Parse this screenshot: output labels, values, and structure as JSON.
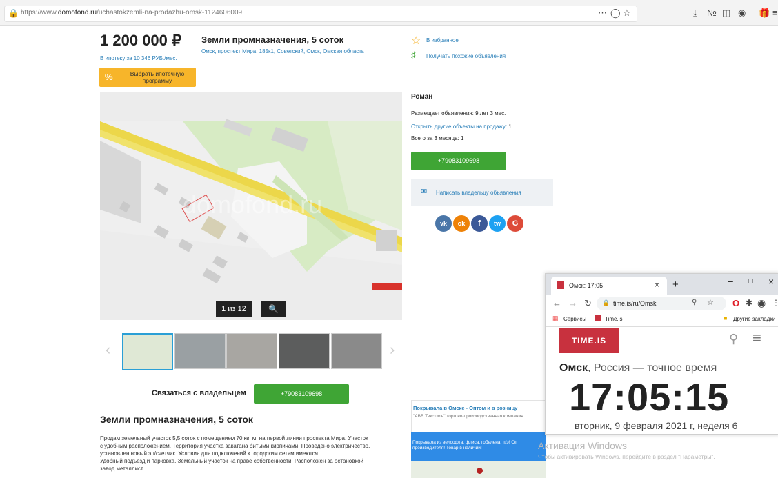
{
  "browser": {
    "url_prefix": "https://www.",
    "url_domain": "domofond.ru",
    "url_path": "/uchastokzemli-na-prodazhu-omsk-1124606009",
    "more_icon": "⋯",
    "pocket_icon": "pocket-icon",
    "bookmark_icon": "star-icon"
  },
  "listing": {
    "price": "1 200 000 ₽",
    "mortgage": "В ипотеку за 10 346 РУБ./мес.",
    "title": "Земли промназначения, 5 соток",
    "address": "Омск, проспект Мира, 185к1, Советский, Омск, Омская область",
    "mortgage_btn_line1": "Выбрать ипотечную",
    "mortgage_btn_line2": "программу",
    "percent_sign": "%",
    "counter": "1 из 12",
    "map_watermark": "domofond.ru",
    "contact_label": "Связаться с владельцем",
    "phone": "+79083109698",
    "section_title": "Земли промназначения, 5 соток",
    "description_1": "Продам земельный участок 5,5 соток с помещением 70 кв. м. на первой линии проспекта Мира. Участок",
    "description_2": "с удобным расположением. Территория участка закатана битыми кирпичами. Проведено электричество,",
    "description_3": "установлен новый эл/счетчик. Условия для подключений к городским сетям имеются.",
    "description_4": "Удобный подъезд и парковка. Земельный участок на праве собственности. Расположен за остановкой",
    "description_5": "завод металлист"
  },
  "sidebar": {
    "favorites": "В избранное",
    "similar": "Получать похожие объявления",
    "owner_name": "Роман",
    "posting": "Размещает объявления: 9 лет 3 мес.",
    "other_objects": "Открыть другие объекты на продажу:",
    "other_count": "1",
    "three_months": "Всего за 3 месяца: 1",
    "phone": "+79083109698",
    "write_owner": "Написать владельцу объявления",
    "social": [
      "vk",
      "ok",
      "f",
      "tw",
      "G"
    ]
  },
  "ad": {
    "title": "Покрывала в Омске - Оптом и в розницу",
    "subtitle": "\"АВВ Текстиль\" торгово-производственная компания",
    "banner_line1": "Покрывала из велсофта, флиса, гобелена, п/э! От",
    "banner_line2": "производителя! Товар в наличии!"
  },
  "timeis": {
    "tab_title": "Омск: 17:05",
    "new_tab": "+",
    "url": "time.is/ru/Omsk",
    "bm_services": "Сервисы",
    "bm_timeis": "Time.is",
    "bm_other": "Другие закладки",
    "logo": "TIME.IS",
    "city": "Омск",
    "rest_heading": ", Россия — точное время",
    "time": "17:05:15",
    "date": "вторник, 9 февраля 2021 г, неделя 6"
  },
  "windows_watermark": {
    "line1": "Активация Windows",
    "line2": "Чтобы активировать Windows, перейдите в раздел \"Параметры\"."
  }
}
